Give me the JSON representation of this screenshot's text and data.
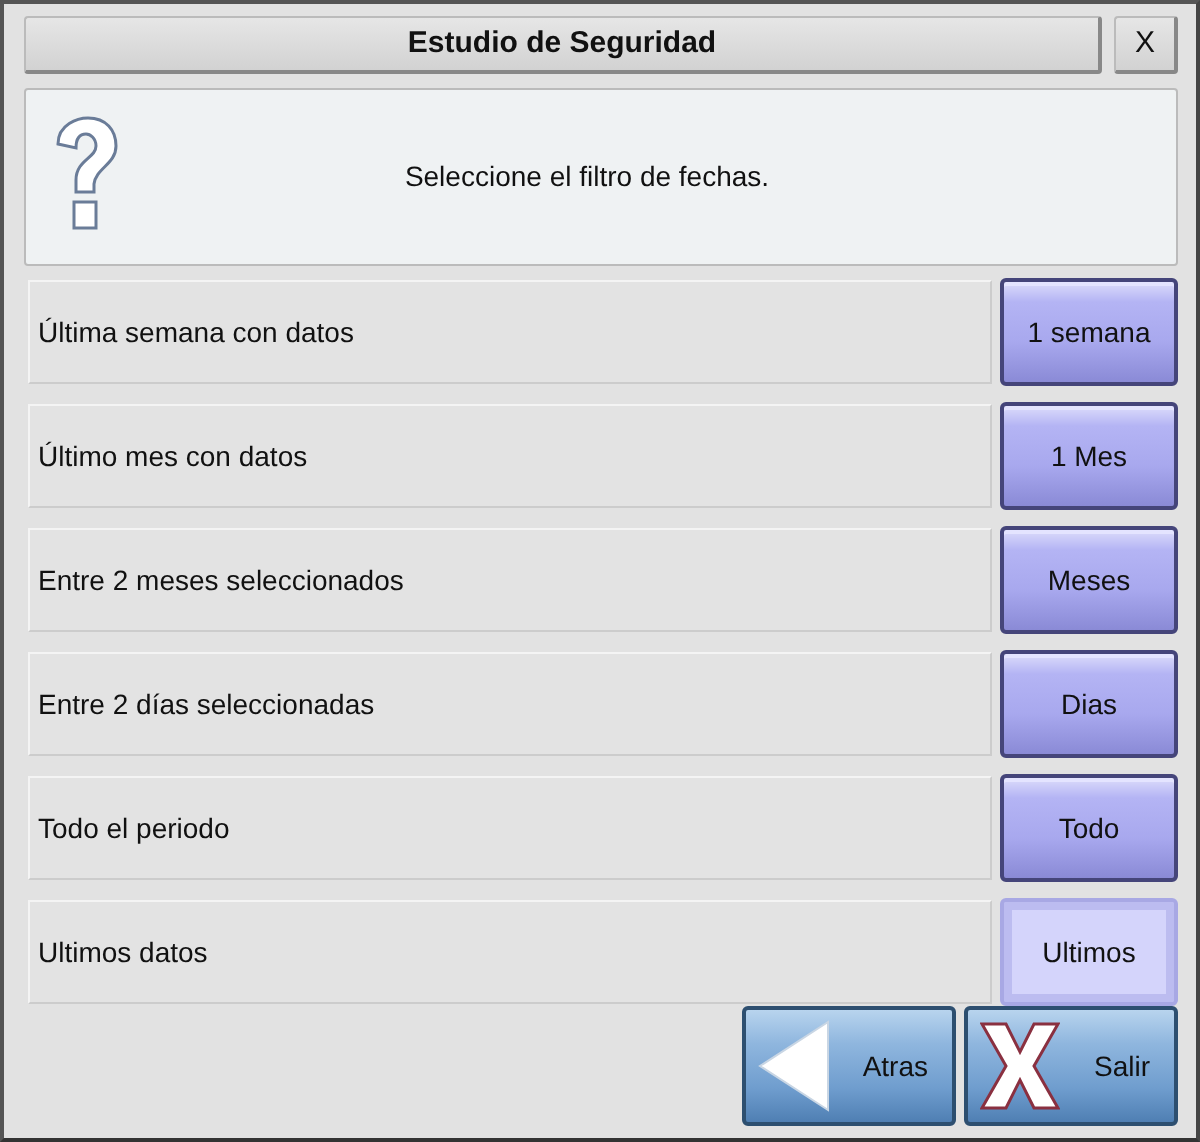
{
  "window": {
    "title": "Estudio de Seguridad",
    "close": "X"
  },
  "message": "Seleccione el filtro de fechas.",
  "options": [
    {
      "label": "Última semana con datos",
      "button": "1 semana",
      "selected": false
    },
    {
      "label": "Último mes con datos",
      "button": "1 Mes",
      "selected": false
    },
    {
      "label": "Entre 2 meses seleccionados",
      "button": "Meses",
      "selected": false
    },
    {
      "label": "Entre 2 días seleccionadas",
      "button": "Dias",
      "selected": false
    },
    {
      "label": "Todo el periodo",
      "button": "Todo",
      "selected": false
    },
    {
      "label": "Ultimos datos",
      "button": "Ultimos",
      "selected": true
    }
  ],
  "actions": [
    {
      "kind": "back",
      "label": "Atras"
    },
    {
      "kind": "exit",
      "label": "Salir"
    }
  ]
}
